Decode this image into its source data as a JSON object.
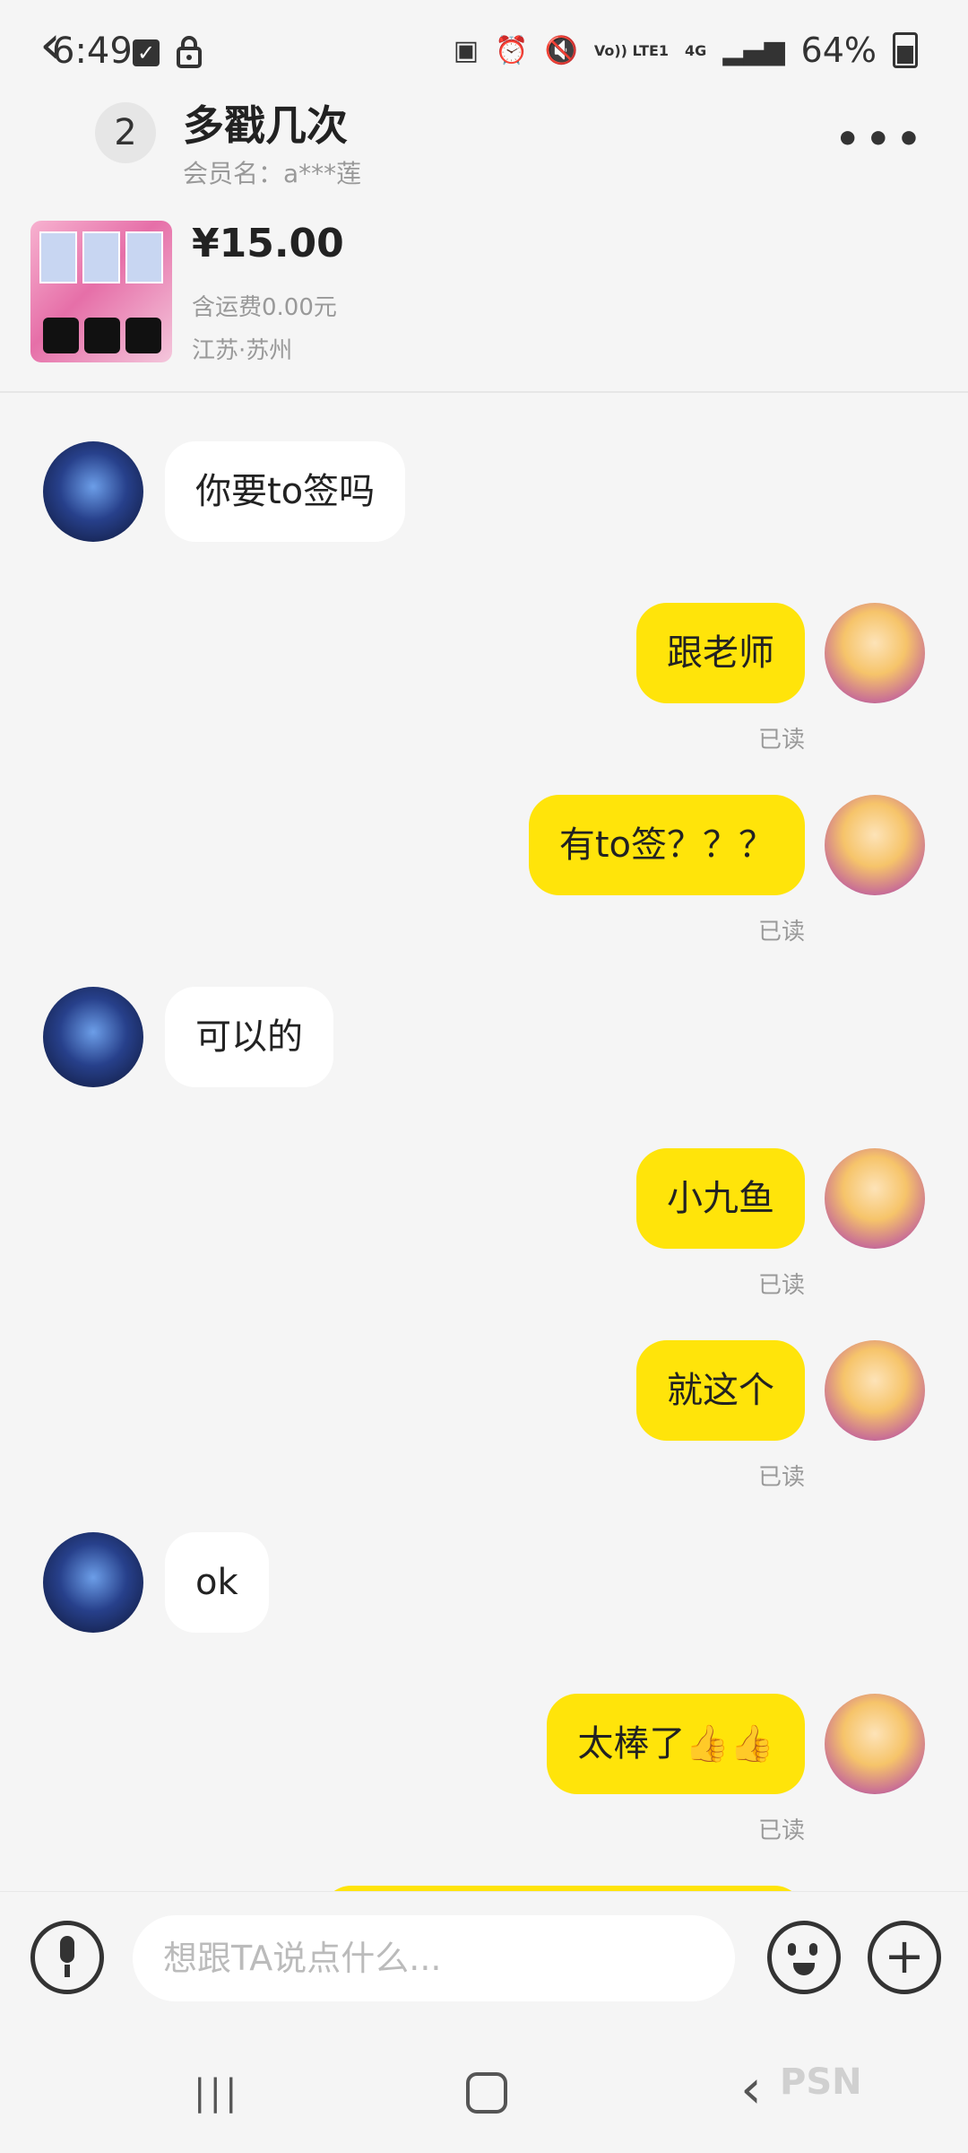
{
  "status_bar": {
    "time": "6:49",
    "network": "4G",
    "volte": "Vo)) LTE1",
    "battery": "64%"
  },
  "header": {
    "unread_count": "2",
    "title": "多戳几次",
    "member_name": "会员名：a***莲"
  },
  "product": {
    "price": "¥15.00",
    "shipping": "含运费0.00元",
    "location": "江苏·苏州"
  },
  "messages": [
    {
      "sender": "other",
      "text": "你要to签吗"
    },
    {
      "sender": "self",
      "text": "跟老师",
      "status": "已读"
    },
    {
      "sender": "self",
      "text": "有to签？？？",
      "status": "已读"
    },
    {
      "sender": "other",
      "text": "可以的"
    },
    {
      "sender": "self",
      "text": "小九鱼",
      "status": "已读"
    },
    {
      "sender": "self",
      "text": "就这个",
      "status": "已读"
    },
    {
      "sender": "other",
      "text": "ok"
    },
    {
      "sender": "self",
      "text": "太棒了👍👍",
      "status": "已读"
    }
  ],
  "partial_top_status": "已读",
  "input": {
    "placeholder": "想跟TA说点什么..."
  },
  "colors": {
    "self_bubble": "#ffe40a",
    "other_bubble": "#ffffff",
    "background": "#f5f5f5"
  },
  "watermark": "PSN"
}
